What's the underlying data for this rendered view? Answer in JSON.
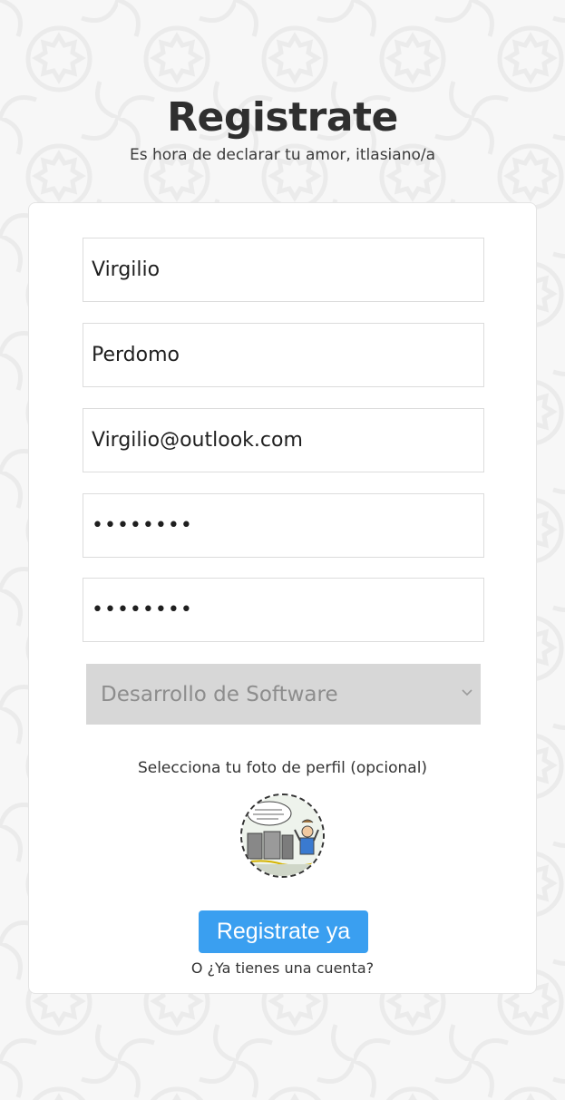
{
  "header": {
    "title": "Registrate",
    "subtitle": "Es hora de declarar tu amor, itlasiano/a"
  },
  "form": {
    "first_name": {
      "value": "Virgilio"
    },
    "last_name": {
      "value": "Perdomo"
    },
    "email": {
      "value": "Virgilio@outlook.com"
    },
    "password": {
      "value": "••••••••"
    },
    "password_confirm": {
      "value": "••••••••"
    },
    "career_select": {
      "selected": "Desarrollo de Software"
    },
    "photo_label": "Selecciona tu foto de perfil (opcional)",
    "submit_label": "Registrate ya",
    "login_link": "O ¿Ya tienes una cuenta?"
  },
  "colors": {
    "accent": "#3a9ff0",
    "background": "#f7f7f7",
    "card": "#ffffff",
    "select_bg": "#d7d7d7"
  },
  "icons": {
    "select_arrow": "chevron-down-icon",
    "avatar": "profile-photo-comic"
  }
}
